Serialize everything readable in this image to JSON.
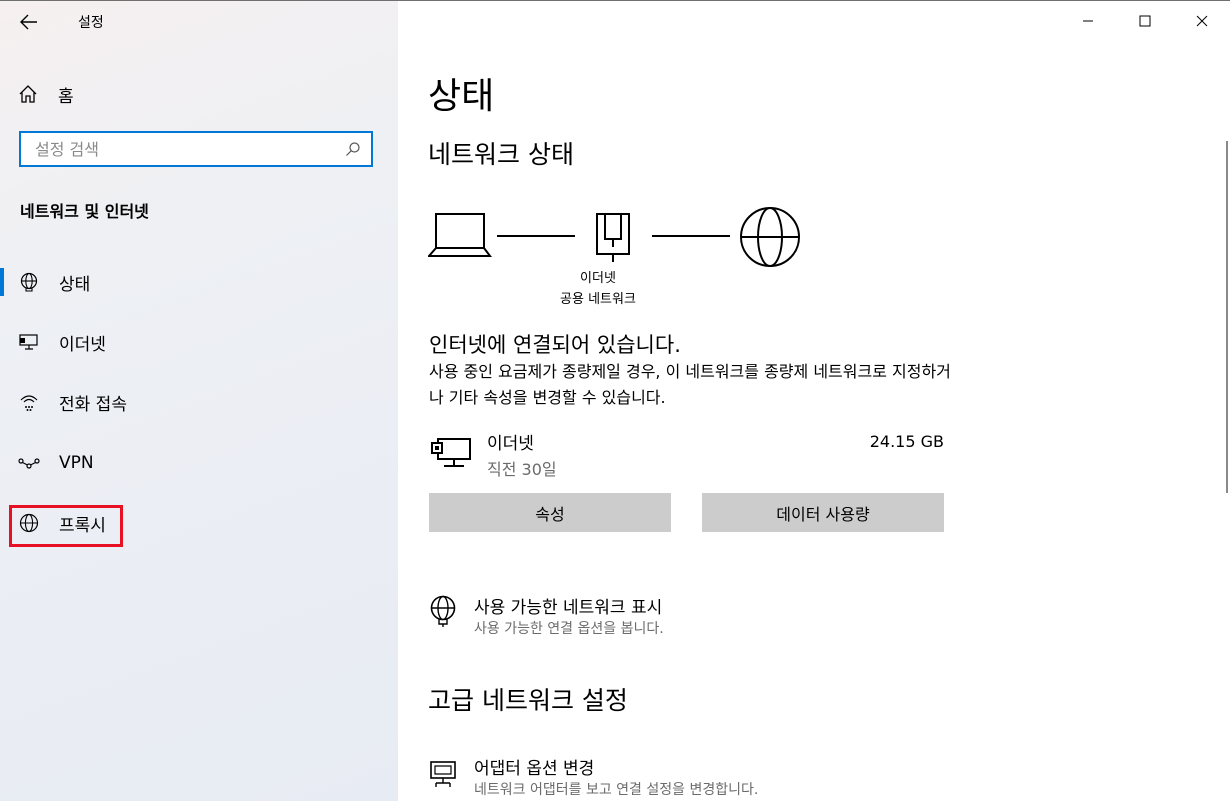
{
  "window": {
    "title": "설정",
    "controls": {
      "minimize": "minimize",
      "maximize": "maximize",
      "close": "close"
    }
  },
  "sidebar": {
    "home_label": "홈",
    "search": {
      "placeholder": "설정 검색",
      "value": ""
    },
    "section_title": "네트워크 및 인터넷",
    "items": [
      {
        "label": "상태",
        "icon": "globe-status-icon",
        "active": true
      },
      {
        "label": "이더넷",
        "icon": "ethernet-icon",
        "active": false
      },
      {
        "label": "전화 접속",
        "icon": "dialup-icon",
        "active": false
      },
      {
        "label": "VPN",
        "icon": "vpn-icon",
        "active": false
      },
      {
        "label": "프록시",
        "icon": "globe-icon",
        "active": false
      }
    ],
    "highlight_color": "#e81123"
  },
  "main": {
    "page_title": "상태",
    "network_status_heading": "네트워크 상태",
    "diagram": {
      "adapter_label": "이더넷",
      "network_label": "공용 네트워크"
    },
    "status_heading": "인터넷에 연결되어 있습니다.",
    "status_description": "사용 중인 요금제가 종량제일 경우, 이 네트워크를 종량제 네트워크로 지정하거나 기타 속성을 변경할 수 있습니다.",
    "connection": {
      "name": "이더넷",
      "subtitle": "직전 30일",
      "usage": "24.15 GB"
    },
    "buttons": {
      "properties": "속성",
      "data_usage": "데이터 사용량"
    },
    "show_networks": {
      "title": "사용 가능한 네트워크 표시",
      "subtitle": "사용 가능한 연결 옵션을 봅니다."
    },
    "advanced_heading": "고급 네트워크 설정",
    "adapter_options": {
      "title": "어댑터 옵션 변경",
      "subtitle": "네트워크 어댑터를 보고 연결 설정을 변경합니다."
    }
  },
  "colors": {
    "accent": "#0078d7",
    "button_bg": "#cccccc",
    "secondary_text": "#6b6b6b"
  }
}
